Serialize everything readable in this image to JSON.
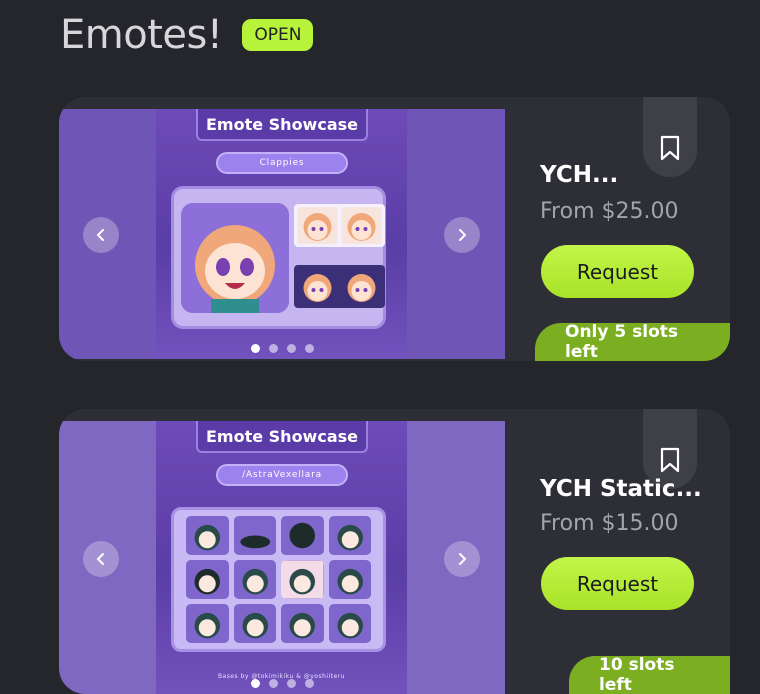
{
  "header": {
    "title": "Emotes!",
    "status": "OPEN"
  },
  "colors": {
    "background": "#25252c",
    "card": "#2e2e36",
    "accent": "#b6f33a",
    "slots_badge": "#7cae22",
    "price_text": "#a3a3ab"
  },
  "cards": [
    {
      "image": {
        "showcase_title": "Emote Showcase",
        "name_pill": "Clappies"
      },
      "carousel": {
        "dots": 4,
        "active_dot": 1
      },
      "name": "YCH...",
      "price": "From $25.00",
      "request_label": "Request",
      "slots": "Only 5 slots left",
      "bookmark_icon": "bookmark-icon"
    },
    {
      "image": {
        "showcase_title": "Emote Showcase",
        "name_pill": "/AstraVexellara",
        "bases_credit": "Bases by @tokimikiku & @yoshiiteru"
      },
      "carousel": {
        "dots": 4,
        "active_dot": 1
      },
      "name": "YCH Static...",
      "price": "From $15.00",
      "request_label": "Request",
      "slots": "10 slots left",
      "bookmark_icon": "bookmark-icon"
    }
  ]
}
